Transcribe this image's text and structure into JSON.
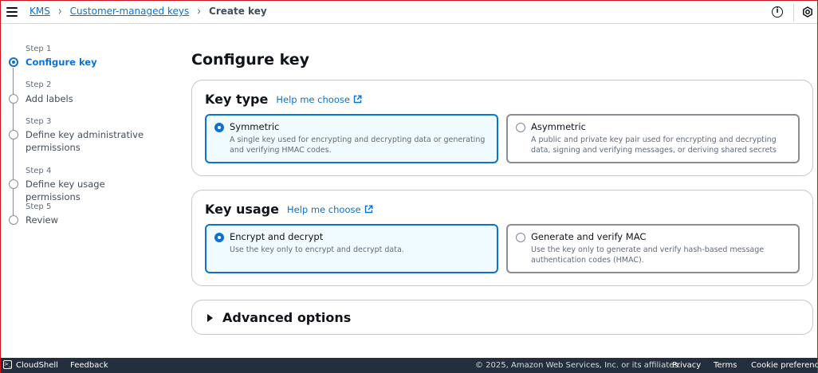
{
  "breadcrumb": {
    "items": [
      {
        "label": "KMS"
      },
      {
        "label": "Customer-managed keys"
      }
    ],
    "current": "Create key"
  },
  "steps": [
    {
      "number": "Step 1",
      "label": "Configure key",
      "active": true
    },
    {
      "number": "Step 2",
      "label": "Add labels",
      "active": false
    },
    {
      "number": "Step 3",
      "label": "Define key administrative permissions",
      "active": false
    },
    {
      "number": "Step 4",
      "label": "Define key usage permissions",
      "active": false
    },
    {
      "number": "Step 5",
      "label": "Review",
      "active": false
    }
  ],
  "page_title": "Configure key",
  "key_type": {
    "title": "Key type",
    "help": "Help me choose",
    "options": [
      {
        "title": "Symmetric",
        "desc": "A single key used for encrypting and decrypting data or generating and verifying HMAC codes.",
        "selected": true
      },
      {
        "title": "Asymmetric",
        "desc": "A public and private key pair used for encrypting and decrypting data, signing and verifying messages, or deriving shared secrets",
        "selected": false
      }
    ]
  },
  "key_usage": {
    "title": "Key usage",
    "help": "Help me choose",
    "options": [
      {
        "title": "Encrypt and decrypt",
        "desc": "Use the key only to encrypt and decrypt data.",
        "selected": true
      },
      {
        "title": "Generate and verify MAC",
        "desc": "Use the key only to generate and verify hash-based message authentication codes (HMAC).",
        "selected": false
      }
    ]
  },
  "advanced": {
    "title": "Advanced options"
  },
  "footer": {
    "cloudshell": "CloudShell",
    "feedback": "Feedback",
    "copyright": "© 2025, Amazon Web Services, Inc. or its affiliates.",
    "privacy": "Privacy",
    "terms": "Terms",
    "cookies": "Cookie preferences"
  },
  "icons": {
    "menu": "hamburger-icon",
    "info": "info-icon",
    "settings": "settings-icon",
    "external": "external-link-icon",
    "cloudshell": "terminal-icon"
  },
  "colors": {
    "accent": "#0972d3",
    "footer_bg": "#232f3e"
  }
}
